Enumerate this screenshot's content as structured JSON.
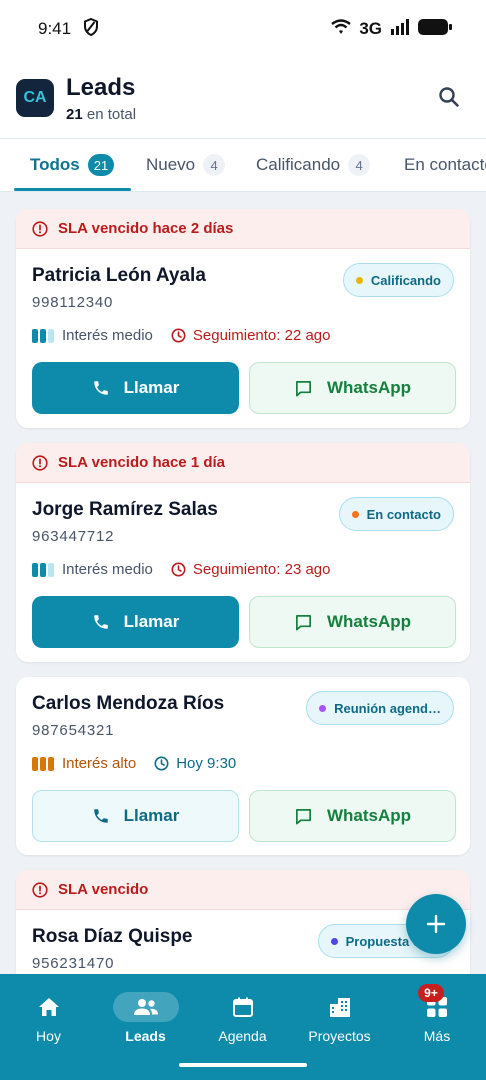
{
  "status_bar": {
    "time": "9:41",
    "network": "3G"
  },
  "header": {
    "avatar_initials": "CA",
    "title": "Leads",
    "total_count": "21",
    "total_suffix": "en total"
  },
  "tabs": [
    {
      "label": "Todos",
      "count": "21"
    },
    {
      "label": "Nuevo",
      "count": "4"
    },
    {
      "label": "Calificando",
      "count": "4"
    },
    {
      "label": "En contacto",
      "count": ""
    }
  ],
  "cards": [
    {
      "sla": "SLA vencido hace 2 días",
      "name": "Patricia León Ayala",
      "phone": "998112340",
      "status": "Calificando",
      "status_color": "#eab308",
      "interest": "Interés medio",
      "follow_up": "Seguimiento: 22 ago",
      "call_label": "Llamar",
      "whatsapp_label": "WhatsApp"
    },
    {
      "sla": "SLA vencido hace 1 día",
      "name": "Jorge Ramírez Salas",
      "phone": "963447712",
      "status": "En contacto",
      "status_color": "#f97316",
      "interest": "Interés medio",
      "follow_up": "Seguimiento: 23 ago",
      "call_label": "Llamar",
      "whatsapp_label": "WhatsApp"
    },
    {
      "sla": "",
      "name": "Carlos Mendoza Ríos",
      "phone": "987654321",
      "status": "Reunión agend…",
      "status_color": "#a855f7",
      "interest": "Interés alto",
      "follow_up": "Hoy 9:30",
      "call_label": "Llamar",
      "whatsapp_label": "WhatsApp"
    },
    {
      "sla": "SLA vencido",
      "name": "Rosa Díaz Quispe",
      "phone": "956231470",
      "status": "Propuesta en…",
      "status_color": "#4f46e5"
    }
  ],
  "bottom_nav": [
    {
      "label": "Hoy",
      "icon": "home-icon"
    },
    {
      "label": "Leads",
      "icon": "users-icon"
    },
    {
      "label": "Agenda",
      "icon": "calendar-icon"
    },
    {
      "label": "Proyectos",
      "icon": "building-icon"
    },
    {
      "label": "Más",
      "icon": "grid-icon",
      "badge": "9+"
    }
  ],
  "colors": {
    "primary": "#0e8bab",
    "danger": "#b91c1c",
    "whatsapp": "#15803d",
    "avatar_bg": "#13253d"
  }
}
